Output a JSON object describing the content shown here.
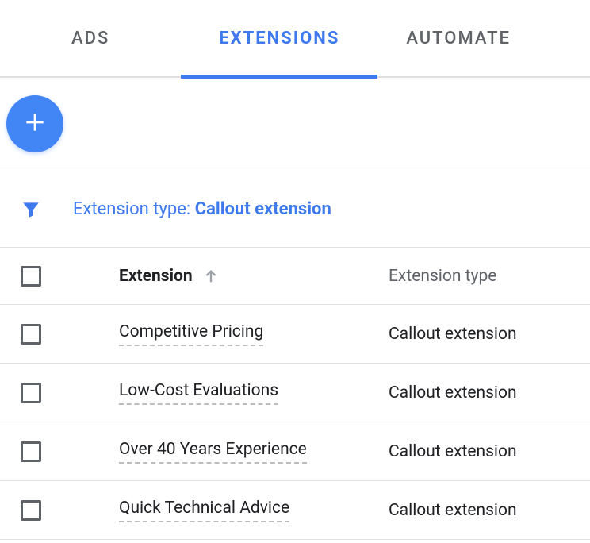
{
  "tabs": {
    "ads": "ADS",
    "extensions": "EXTENSIONS",
    "automated": "AUTOMATE"
  },
  "filter": {
    "label": "Extension type: ",
    "value": "Callout extension"
  },
  "columns": {
    "extension": "Extension",
    "type": "Extension type"
  },
  "rows": [
    {
      "name": "Competitive Pricing",
      "type": "Callout extension"
    },
    {
      "name": "Low-Cost Evaluations",
      "type": "Callout extension"
    },
    {
      "name": "Over 40 Years Experience",
      "type": "Callout extension"
    },
    {
      "name": "Quick Technical Advice",
      "type": "Callout extension"
    }
  ]
}
